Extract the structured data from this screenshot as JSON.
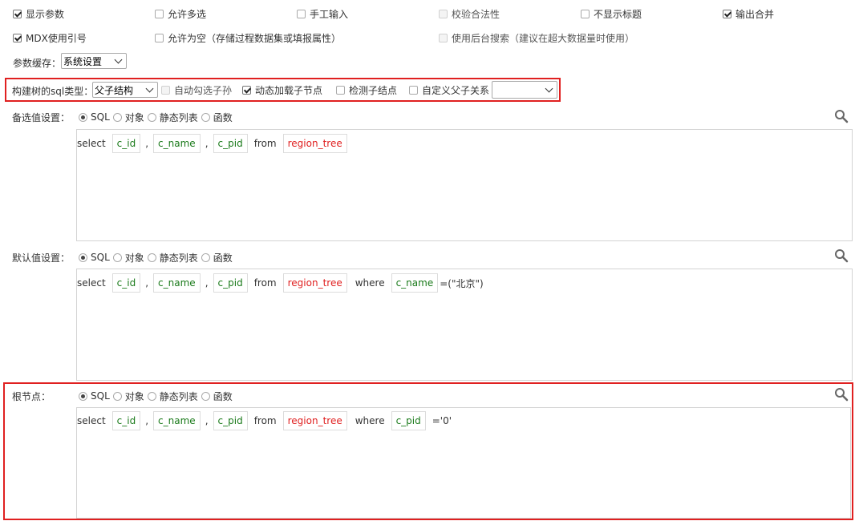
{
  "options_row1": [
    {
      "label": "显示参数",
      "checked": true,
      "disabled": false
    },
    {
      "label": "允许多选",
      "checked": false,
      "disabled": false
    },
    {
      "label": "手工输入",
      "checked": false,
      "disabled": false
    },
    {
      "label": "校验合法性",
      "checked": false,
      "disabled": true
    },
    {
      "label": "不显示标题",
      "checked": false,
      "disabled": false
    },
    {
      "label": "输出合并",
      "checked": true,
      "disabled": false
    }
  ],
  "options_row2": [
    {
      "label": "MDX使用引号",
      "checked": true,
      "disabled": false
    },
    {
      "label": "允许为空（存储过程数据集或填报属性）",
      "checked": false,
      "disabled": false
    },
    {
      "label": "使用后台搜索（建议在超大数据量时使用）",
      "checked": false,
      "disabled": true
    }
  ],
  "cache": {
    "label": "参数缓存：",
    "value": "系统设置"
  },
  "tree": {
    "label": "构建树的sql类型：",
    "type_value": "父子结构",
    "auto_check": "自动勾选子孙",
    "dynamic_load": "动态加载子节点",
    "detect_child": "检测子结点",
    "custom_relation": "自定义父子关系",
    "custom_value": ""
  },
  "radio_options": [
    "SQL",
    "对象",
    "静态列表",
    "函数"
  ],
  "sections": [
    {
      "label": "备选值设置：",
      "selected": "SQL",
      "sql": {
        "select": "select",
        "f1": "c_id",
        "f2": "c_name",
        "f3": "c_pid",
        "from": "from",
        "table": "region_tree"
      }
    },
    {
      "label": "默认值设置：",
      "selected": "SQL",
      "sql": {
        "select": "select",
        "f1": "c_id",
        "f2": "c_name",
        "f3": "c_pid",
        "from": "from",
        "table": "region_tree",
        "where": "where",
        "cond_field": "c_name",
        "cond_value": "=(\"北京\")"
      }
    },
    {
      "label": "根节点：",
      "selected": "SQL",
      "sql": {
        "select": "select",
        "f1": "c_id",
        "f2": "c_name",
        "f3": "c_pid",
        "from": "from",
        "table": "region_tree",
        "where": "where",
        "cond_field": "c_pid",
        "cond_value": "='0'"
      }
    }
  ],
  "comma": ",",
  "colors": {
    "field": "#1a7a1a",
    "table": "#e02020",
    "highlight": "#e02020"
  }
}
